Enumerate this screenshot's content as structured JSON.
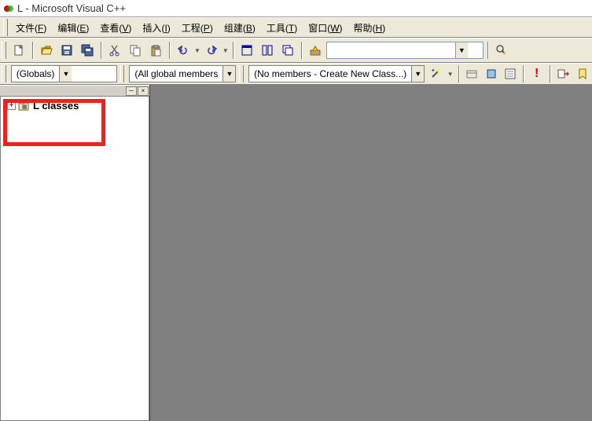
{
  "window": {
    "title": "L - Microsoft Visual C++"
  },
  "menu": {
    "items": [
      {
        "label": "文件",
        "accel": "F"
      },
      {
        "label": "编辑",
        "accel": "E"
      },
      {
        "label": "查看",
        "accel": "V"
      },
      {
        "label": "插入",
        "accel": "I"
      },
      {
        "label": "工程",
        "accel": "P"
      },
      {
        "label": "组建",
        "accel": "B"
      },
      {
        "label": "工具",
        "accel": "T"
      },
      {
        "label": "窗口",
        "accel": "W"
      },
      {
        "label": "帮助",
        "accel": "H"
      }
    ]
  },
  "toolbar": {
    "find_value": "",
    "find_placeholder": ""
  },
  "wizbar": {
    "scope": "(Globals)",
    "filter": "(All global members",
    "members": "(No members - Create New Class...)"
  },
  "classview": {
    "root": "L classes"
  },
  "icons": {
    "new": "new-file-icon",
    "open": "open-icon",
    "save": "save-icon",
    "saveall": "save-all-icon",
    "cut": "cut-icon",
    "copy": "copy-icon",
    "paste": "paste-icon",
    "undo": "undo-icon",
    "redo": "redo-icon",
    "win1": "window-list-icon",
    "win2": "window-tile-icon",
    "win3": "window-cascade-icon",
    "build": "build-icon",
    "find": "find-in-files-icon",
    "wand": "wizard-wand-icon",
    "box1": "open-class-icon",
    "box2": "resource-icon",
    "box3": "properties-icon",
    "excl": "error-icon",
    "arr1": "go-to-icon",
    "arr2": "bookmark-icon"
  }
}
